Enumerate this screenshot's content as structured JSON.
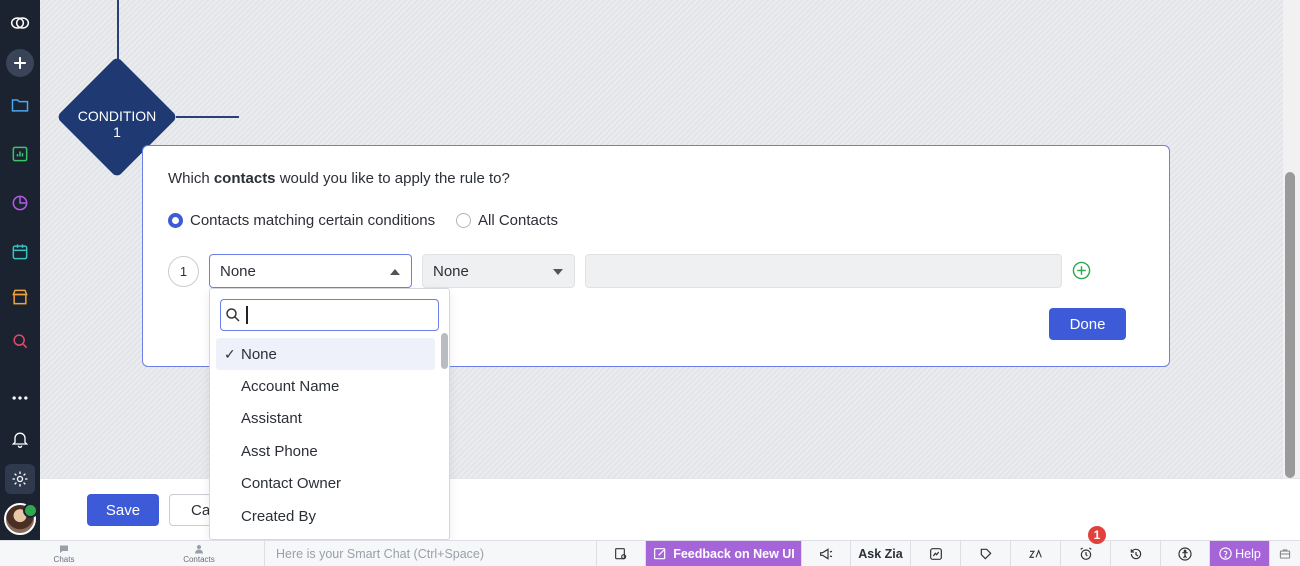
{
  "condition": {
    "badge_label": "CONDITION",
    "badge_number": "1",
    "question_prefix": "Which ",
    "question_bold": "contacts",
    "question_suffix": " would you like to apply the rule to?",
    "radio_options": [
      {
        "label": "Contacts matching certain conditions",
        "selected": true
      },
      {
        "label": "All Contacts",
        "selected": false
      }
    ],
    "rule_row": {
      "index": "1",
      "field_value": "None",
      "operator_value": "None",
      "value": ""
    },
    "done_label": "Done"
  },
  "dropdown": {
    "search_value": "",
    "selected_check": "✓",
    "items": [
      "None",
      "Account Name",
      "Assistant",
      "Asst Phone",
      "Contact Owner",
      "Created By"
    ]
  },
  "footer": {
    "save_label": "Save",
    "cancel_label": "Ca"
  },
  "bottom_bar": {
    "chats_label": "Chats",
    "contacts_label": "Contacts",
    "smart_chat_placeholder": "Here is your Smart Chat (Ctrl+Space)",
    "feedback_label": "Feedback on New UI",
    "ask_zia_label": "Ask Zia",
    "notification_count": "1",
    "help_label": "Help"
  },
  "colors": {
    "accent": "#3d5bd9",
    "nav_bg": "#1b2331",
    "condition_diamond": "#1f3a72",
    "feedback_bg": "#a565d9",
    "add_icon": "#2ea84f",
    "badge_red": "#e2403c"
  }
}
